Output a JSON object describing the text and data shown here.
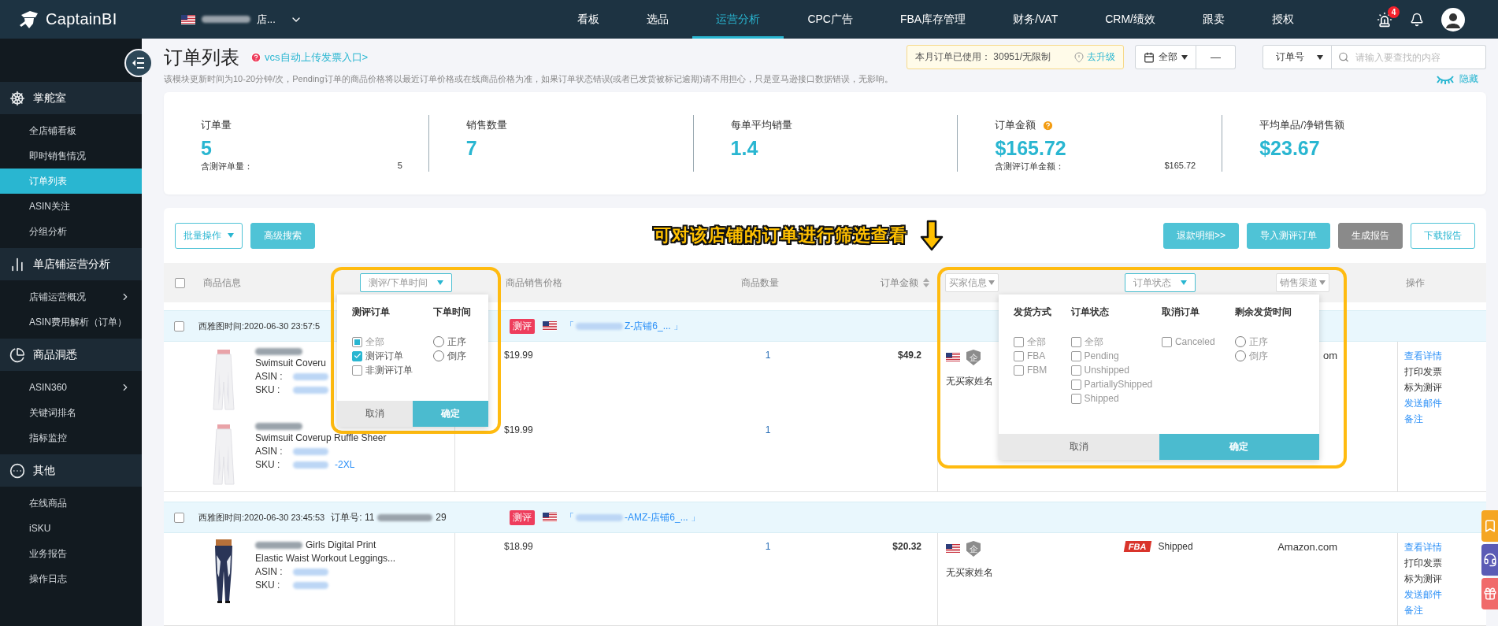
{
  "topbar": {
    "brand": "CaptainBI",
    "store": "店...",
    "alert_count": "4",
    "nav": [
      {
        "label": "看板",
        "selected": false
      },
      {
        "label": "选品",
        "selected": false
      },
      {
        "label": "运营分析",
        "selected": true
      },
      {
        "label": "CPC广告",
        "selected": false
      },
      {
        "label": "FBA库存管理",
        "selected": false
      },
      {
        "label": "财务/VAT",
        "selected": false
      },
      {
        "label": "CRM/绩效",
        "selected": false
      },
      {
        "label": "跟卖",
        "selected": false
      },
      {
        "label": "授权",
        "selected": false
      }
    ]
  },
  "sidebar": {
    "sections": [
      {
        "title": "掌舵室",
        "items": [
          {
            "label": "全店铺看板",
            "selected": false
          },
          {
            "label": "即时销售情况",
            "selected": false
          },
          {
            "label": "订单列表",
            "selected": true
          },
          {
            "label": "ASIN关注",
            "selected": false
          },
          {
            "label": "分组分析",
            "selected": false
          }
        ]
      },
      {
        "title": "单店铺运营分析",
        "items": [
          {
            "label": "店铺运营概况",
            "selected": false,
            "expandable": true
          },
          {
            "label": "ASIN费用解析（订单）",
            "selected": false
          }
        ]
      },
      {
        "title": "商品洞悉",
        "items": [
          {
            "label": "ASIN360",
            "selected": false,
            "expandable": true
          },
          {
            "label": "关键词排名",
            "selected": false
          },
          {
            "label": "指标监控",
            "selected": false
          }
        ]
      },
      {
        "title": "其他",
        "items": [
          {
            "label": "在线商品",
            "selected": false
          },
          {
            "label": "iSKU",
            "selected": false
          },
          {
            "label": "业务报告",
            "selected": false
          },
          {
            "label": "操作日志",
            "selected": false
          }
        ]
      }
    ]
  },
  "header": {
    "title": "订单列表",
    "help_link": "vcs自动上传发票入口>",
    "usage_label": "本月订单已使用：",
    "usage_value": "30951/无限制",
    "upgrade": "去升级",
    "date_range": "全部",
    "date_separator": "—",
    "search_field": "订单号",
    "search": {
      "placeholder": "请输入要查找的内容"
    },
    "notice": "该模块更新时间为10-20分钟/次，Pending订单的商品价格将以最近订单价格或在线商品价格为准，如果订单状态错误(或者已发货被标记逾期)请不用担心，只是亚马逊接口数据错误，无影响。",
    "hide": "隐藏"
  },
  "stats": [
    {
      "label": "订单量",
      "value": "5",
      "sub_label": "含测评单量：",
      "sub_value": "5"
    },
    {
      "label": "销售数量",
      "value": "7"
    },
    {
      "label": "每单平均销量",
      "value": "1.4"
    },
    {
      "label": "订单金额",
      "value": "$165.72",
      "help": true,
      "sub_label": "含测评订单金额：",
      "sub_value": "$165.72"
    },
    {
      "label": "平均单品/净销售额",
      "value": "$23.67"
    }
  ],
  "toolbar": {
    "batch": "批量操作",
    "advanced_search": "高级搜索",
    "annotation": "可对该店铺的订单进行筛选查看",
    "buttons": [
      {
        "label": "退款明细>>",
        "kind": "primary"
      },
      {
        "label": "导入测评订单",
        "kind": "primary"
      },
      {
        "label": "生成报告",
        "kind": "gray"
      },
      {
        "label": "下载报告",
        "kind": "outline"
      }
    ]
  },
  "select_all": {
    "checked": false
  },
  "columns": [
    {
      "label": "商品信息",
      "kind": "text"
    },
    {
      "label": "测评/下单时间",
      "kind": "filter",
      "active": true
    },
    {
      "label": "商品销售价格",
      "kind": "text"
    },
    {
      "label": "商品数量",
      "kind": "text"
    },
    {
      "label": "订单金额",
      "kind": "sort"
    },
    {
      "label": "买家信息",
      "kind": "filter",
      "active": false
    },
    {
      "label": "订单状态",
      "kind": "filter",
      "active": true
    },
    {
      "label": "销售渠道",
      "kind": "filter",
      "active": false
    },
    {
      "label": "操作",
      "kind": "text"
    }
  ],
  "orders": [
    {
      "checked": false,
      "time": "西雅图时间:2020-06-30 23:57:5",
      "badge": "测评",
      "bracket_open": "「",
      "store_link": "Z-店铺6_...",
      "bracket_close": "」",
      "amount": "$49.2",
      "buyer": {
        "name": "无买家姓名",
        "badge": "企"
      },
      "channel": "om",
      "products": [
        {
          "title_lines": [
            "Swimsuit Coveru"
          ],
          "asin_label": "ASIN :",
          "sku_label": "SKU :",
          "price": "$19.99",
          "qty": "1"
        },
        {
          "title_lines": [
            "Swimsuit Coverup Ruffle Sheer"
          ],
          "asin_label": "ASIN :",
          "sku_label": "SKU :",
          "sku_tail": "-2XL",
          "price": "$19.99",
          "qty": "1"
        }
      ],
      "actions": [
        {
          "label": "查看详情",
          "kind": "link"
        },
        {
          "label": "打印发票",
          "kind": "text"
        },
        {
          "label": "标为测评",
          "kind": "text"
        },
        {
          "label": "发送邮件",
          "kind": "link"
        },
        {
          "label": "备注",
          "kind": "link"
        }
      ]
    },
    {
      "checked": false,
      "time": "西雅图时间:2020-06-30 23:45:53",
      "order_no_label": "订单号:",
      "order_no_start": "11",
      "order_no_end": "29",
      "badge": "测评",
      "bracket_open": "「",
      "store_link": "-AMZ-店铺6_...",
      "bracket_close": "」",
      "amount": "$20.32",
      "buyer": {
        "name": "无买家姓名",
        "badge": "企"
      },
      "status": {
        "fulfillment": "FBA",
        "label": "Shipped"
      },
      "channel": "Amazon.com",
      "products": [
        {
          "title_inline": true,
          "title_lines": [
            "Girls Digital Print",
            "Elastic Waist Workout Leggings..."
          ],
          "asin_label": "ASIN :",
          "sku_label": "SKU :",
          "price": "$18.99",
          "qty": "1"
        }
      ],
      "actions": [
        {
          "label": "查看详情",
          "kind": "link"
        },
        {
          "label": "打印发票",
          "kind": "text"
        },
        {
          "label": "标为测评",
          "kind": "text"
        },
        {
          "label": "发送邮件",
          "kind": "link"
        },
        {
          "label": "备注",
          "kind": "link"
        }
      ]
    }
  ],
  "filters": {
    "time": {
      "cancel": "取消",
      "confirm": "确定",
      "columns": [
        {
          "title": "测评订单",
          "kind": "checkbox",
          "options": [
            {
              "label": "全部",
              "checked": false,
              "indeterminate": true
            },
            {
              "label": "测评订单",
              "checked": true
            },
            {
              "label": "非测评订单",
              "checked": false
            }
          ]
        },
        {
          "title": "下单时间",
          "kind": "radio",
          "options": [
            {
              "label": "正序",
              "selected": false
            },
            {
              "label": "倒序",
              "selected": false
            }
          ]
        }
      ]
    },
    "status": {
      "cancel": "取消",
      "confirm": "确定",
      "columns": [
        {
          "title": "发货方式",
          "kind": "checkbox",
          "options": [
            {
              "label": "全部",
              "checked": false
            },
            {
              "label": "FBA",
              "checked": false
            },
            {
              "label": "FBM",
              "checked": false
            }
          ]
        },
        {
          "title": "订单状态",
          "kind": "checkbox",
          "options": [
            {
              "label": "全部",
              "checked": false
            },
            {
              "label": "Pending",
              "checked": false
            },
            {
              "label": "Unshipped",
              "checked": false
            },
            {
              "label": "PartiallyShipped",
              "checked": false
            },
            {
              "label": "Shipped",
              "checked": false
            }
          ]
        },
        {
          "title": "取消订单",
          "kind": "checkbox",
          "options": [
            {
              "label": "Canceled",
              "checked": false
            }
          ]
        },
        {
          "title": "剩余发货时间",
          "kind": "radio",
          "options": [
            {
              "label": "正序",
              "selected": false
            },
            {
              "label": "倒序",
              "selected": false
            }
          ]
        }
      ]
    }
  }
}
